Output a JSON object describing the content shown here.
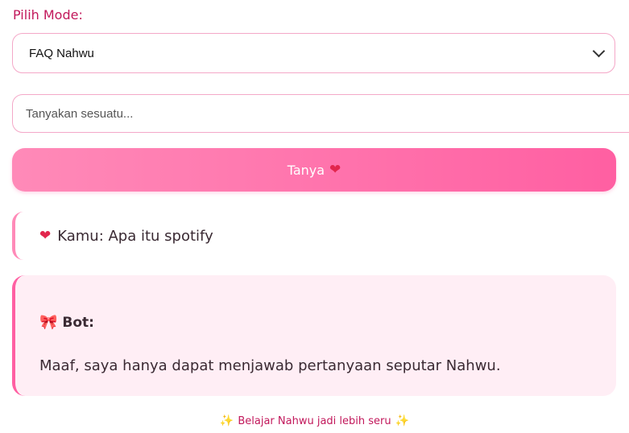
{
  "mode": {
    "label": "Pilih Mode:",
    "selected": "FAQ Nahwu"
  },
  "question": {
    "placeholder": "Tanyakan sesuatu...",
    "value": ""
  },
  "ask_button": {
    "label": "Tanya",
    "icon": "heart-icon"
  },
  "chat": {
    "user_message": "Kamu: Apa itu spotify",
    "bot_label": "Bot:",
    "bot_answer": "Maaf, saya hanya dapat menjawab pertanyaan seputar Nahwu."
  },
  "footer": {
    "text": "Belajar Nahwu jadi lebih seru"
  },
  "colors": {
    "accent": "#ff5fa2",
    "label": "#c2185b",
    "bot_bg": "#ffeef5"
  }
}
